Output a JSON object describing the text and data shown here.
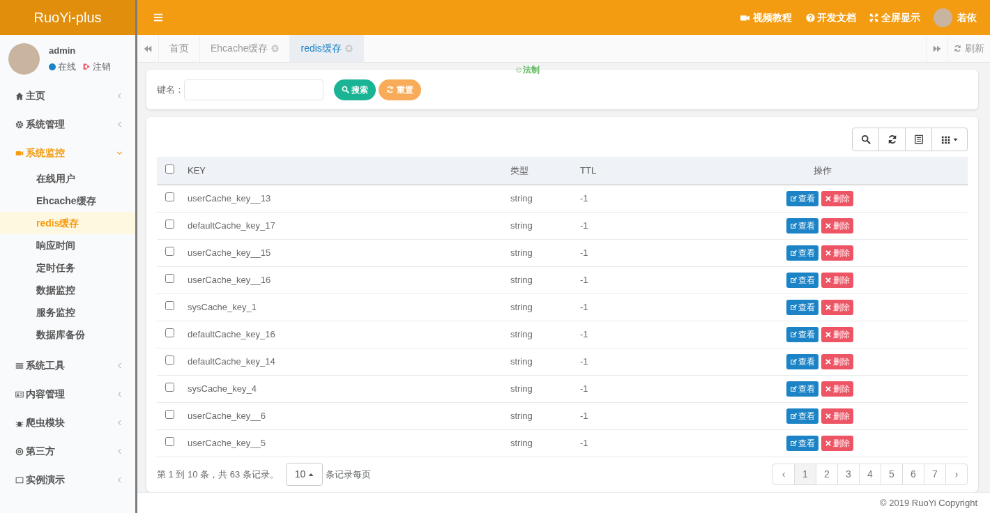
{
  "sidebar": {
    "logo": "RuoYi-plus",
    "user": {
      "name": "admin",
      "status": "在线",
      "logout": "注销"
    },
    "menu": [
      {
        "label": "主页",
        "expanded": false,
        "active": false
      },
      {
        "label": "系统管理",
        "expanded": false,
        "active": false
      },
      {
        "label": "系统监控",
        "expanded": true,
        "active": true,
        "children": [
          {
            "label": "在线用户",
            "selected": false
          },
          {
            "label": "Ehcache缓存",
            "selected": false
          },
          {
            "label": "redis缓存",
            "selected": true
          },
          {
            "label": "响应时间",
            "selected": false
          },
          {
            "label": "定时任务",
            "selected": false
          },
          {
            "label": "数据监控",
            "selected": false
          },
          {
            "label": "服务监控",
            "selected": false
          },
          {
            "label": "数据库备份",
            "selected": false
          }
        ]
      },
      {
        "label": "系统工具",
        "expanded": false,
        "active": false
      },
      {
        "label": "内容管理",
        "expanded": false,
        "active": false
      },
      {
        "label": "爬虫模块",
        "expanded": false,
        "active": false
      },
      {
        "label": "第三方",
        "expanded": false,
        "active": false
      },
      {
        "label": "实例演示",
        "expanded": false,
        "active": false
      }
    ]
  },
  "header": {
    "links": [
      "视频教程",
      "开发文档",
      "全屏显示"
    ],
    "user": "若依"
  },
  "tabs": [
    {
      "label": "首页",
      "selected": false,
      "closable": false
    },
    {
      "label": "Ehcache缓存",
      "selected": false,
      "closable": true
    },
    {
      "label": "redis缓存",
      "selected": true,
      "closable": true
    }
  ],
  "refresh": "刷新",
  "notice": "☺法制",
  "search": {
    "label": "键名：",
    "buttons": [
      "搜索",
      "重置"
    ]
  },
  "table": {
    "columns": [
      "KEY",
      "类型",
      "TTL",
      "操作"
    ],
    "all_checked": false,
    "rows": [
      {
        "key": "userCache_key__13",
        "type": "string",
        "ttl": "-1",
        "checked": false,
        "actions": [
          "查看",
          "删除"
        ]
      },
      {
        "key": "defaultCache_key_17",
        "type": "string",
        "ttl": "-1",
        "checked": false,
        "actions": [
          "查看",
          "删除"
        ]
      },
      {
        "key": "userCache_key__15",
        "type": "string",
        "ttl": "-1",
        "checked": false,
        "actions": [
          "查看",
          "删除"
        ]
      },
      {
        "key": "userCache_key__16",
        "type": "string",
        "ttl": "-1",
        "checked": false,
        "actions": [
          "查看",
          "删除"
        ]
      },
      {
        "key": "sysCache_key_1",
        "type": "string",
        "ttl": "-1",
        "checked": false,
        "actions": [
          "查看",
          "删除"
        ]
      },
      {
        "key": "defaultCache_key_16",
        "type": "string",
        "ttl": "-1",
        "checked": false,
        "actions": [
          "查看",
          "删除"
        ]
      },
      {
        "key": "defaultCache_key_14",
        "type": "string",
        "ttl": "-1",
        "checked": false,
        "actions": [
          "查看",
          "删除"
        ]
      },
      {
        "key": "sysCache_key_4",
        "type": "string",
        "ttl": "-1",
        "checked": false,
        "actions": [
          "查看",
          "删除"
        ]
      },
      {
        "key": "userCache_key__6",
        "type": "string",
        "ttl": "-1",
        "checked": false,
        "actions": [
          "查看",
          "删除"
        ]
      },
      {
        "key": "userCache_key__5",
        "type": "string",
        "ttl": "-1",
        "checked": false,
        "actions": [
          "查看",
          "删除"
        ]
      }
    ]
  },
  "pagination": {
    "summary": "第 1 到 10 条，共 63 条记录。",
    "page_size": "10",
    "per_page": "条记录每页",
    "prev": "‹",
    "next": "›",
    "pages": [
      {
        "label": "1",
        "selected": true
      },
      {
        "label": "2",
        "selected": false
      },
      {
        "label": "3",
        "selected": false
      },
      {
        "label": "4",
        "selected": false
      },
      {
        "label": "5",
        "selected": false
      },
      {
        "label": "6",
        "selected": false
      },
      {
        "label": "7",
        "selected": false
      }
    ]
  },
  "footer": "© 2019 RuoYi Copyright"
}
